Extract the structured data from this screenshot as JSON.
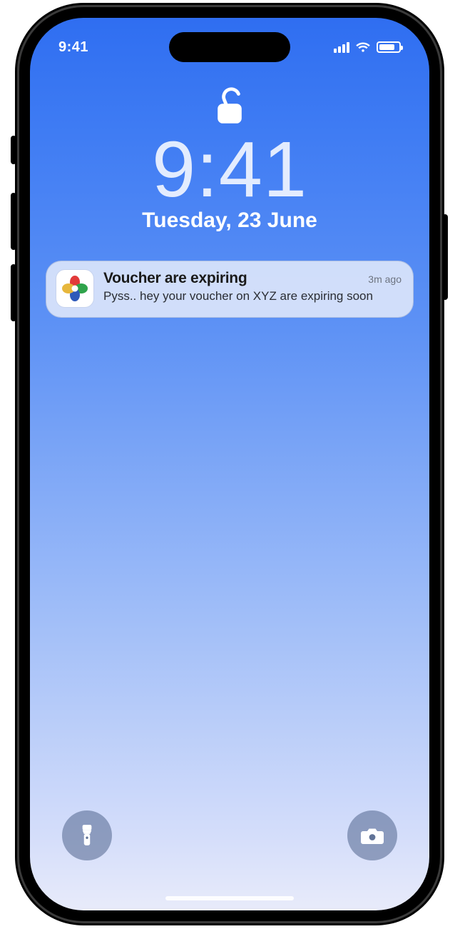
{
  "status_bar": {
    "time": "9:41",
    "signal_bars": 4,
    "wifi": true,
    "battery_pct": 80
  },
  "lock_state": "unlocked",
  "clock": {
    "time": "9:41",
    "date": "Tuesday, 23 June"
  },
  "notification": {
    "app_icon": "multicolor-petals-icon",
    "title": "Voucher are expiring",
    "time_ago": "3m ago",
    "message": "Pyss.. hey your voucher on XYZ are expiring soon"
  },
  "quick_actions": {
    "left": "flashlight",
    "right": "camera"
  }
}
